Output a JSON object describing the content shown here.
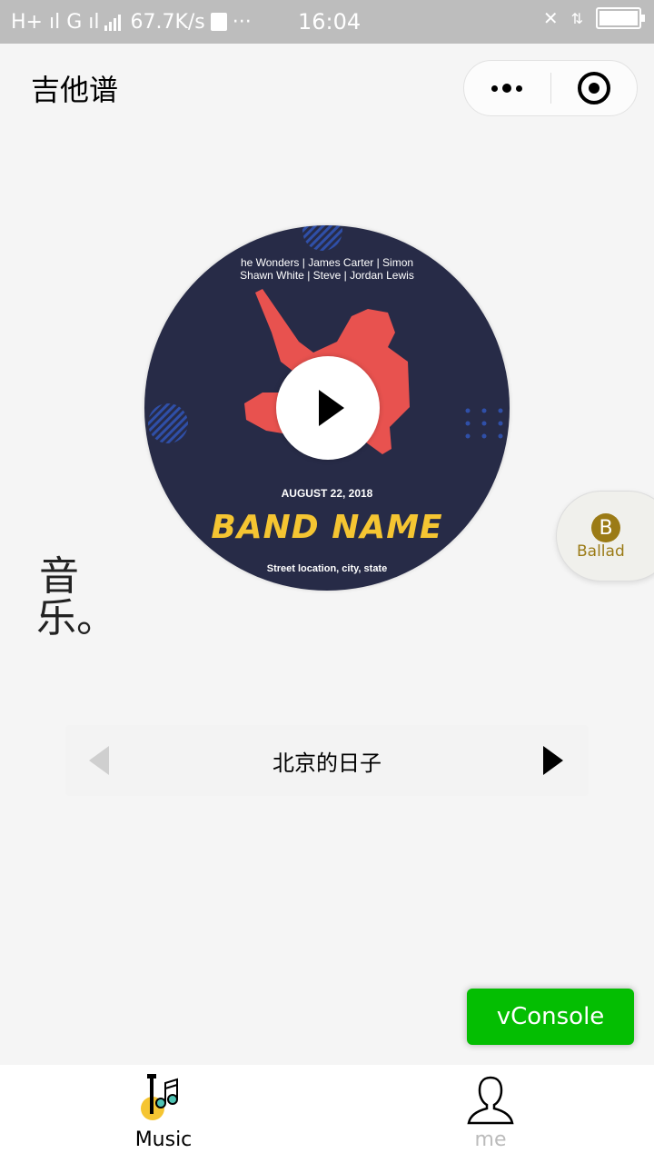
{
  "status_bar": {
    "network": "H+ ıl G ıl",
    "speed": "67.7K/s",
    "more": "···",
    "time": "16:04",
    "battery_level": 1.0
  },
  "nav": {
    "title": "吉他谱",
    "more_icon": "more-dots-icon",
    "close_icon": "target-icon"
  },
  "album": {
    "names_line1": "he Wonders  |  James Carter  |  Simon",
    "names_line2": "Shawn White  |  Steve  |  Jordan Lewis",
    "date": "AUGUST 22, 2018",
    "band": "BAND NAME",
    "location": "Street location, city, state",
    "colors": {
      "background": "#272b47",
      "figure": "#e8524f",
      "band": "#f5c532"
    }
  },
  "ballad": {
    "letter": "B",
    "label": "Ballad"
  },
  "side_text": "音乐。",
  "player": {
    "song_title": "北京的日子"
  },
  "vconsole": {
    "label": "vConsole"
  },
  "tabs": [
    {
      "label": "Music",
      "icon": "guitar-music-icon",
      "active": true
    },
    {
      "label": "me",
      "icon": "user-icon",
      "active": false
    }
  ],
  "colors": {
    "accent": "#04be02",
    "tab_inactive": "#bbbbbb"
  }
}
